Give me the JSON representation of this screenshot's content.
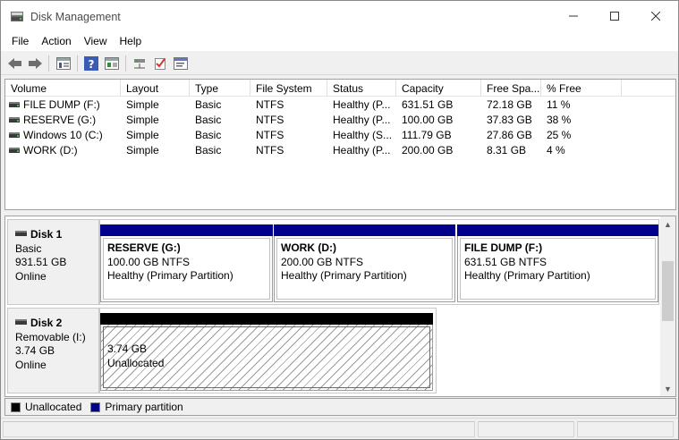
{
  "window": {
    "title": "Disk Management"
  },
  "menu": [
    "File",
    "Action",
    "View",
    "Help"
  ],
  "toolbar": [
    "back-icon",
    "forward-icon",
    "disk-list-icon",
    "help-icon",
    "properties-icon",
    "connect-icon",
    "check-icon",
    "console-icon"
  ],
  "volume_table": {
    "columns": [
      "Volume",
      "Layout",
      "Type",
      "File System",
      "Status",
      "Capacity",
      "Free Spa...",
      "% Free"
    ],
    "rows": [
      [
        "FILE DUMP (F:)",
        "Simple",
        "Basic",
        "NTFS",
        "Healthy (P...",
        "631.51 GB",
        "72.18 GB",
        "11 %"
      ],
      [
        "RESERVE (G:)",
        "Simple",
        "Basic",
        "NTFS",
        "Healthy (P...",
        "100.00 GB",
        "37.83 GB",
        "38 %"
      ],
      [
        "Windows 10 (C:)",
        "Simple",
        "Basic",
        "NTFS",
        "Healthy (S...",
        "111.79 GB",
        "27.86 GB",
        "25 %"
      ],
      [
        "WORK (D:)",
        "Simple",
        "Basic",
        "NTFS",
        "Healthy (P...",
        "200.00 GB",
        "8.31 GB",
        "4 %"
      ]
    ]
  },
  "disks": [
    {
      "name": "Disk 1",
      "type": "Basic",
      "size": "931.51 GB",
      "status": "Online",
      "partitions": [
        {
          "name": "RESERVE  (G:)",
          "size": "100.00 GB NTFS",
          "status": "Healthy (Primary Partition)"
        },
        {
          "name": "WORK  (D:)",
          "size": "200.00 GB NTFS",
          "status": "Healthy (Primary Partition)"
        },
        {
          "name": "FILE DUMP  (F:)",
          "size": "631.51 GB NTFS",
          "status": "Healthy (Primary Partition)"
        }
      ]
    },
    {
      "name": "Disk 2",
      "type": "Removable (I:)",
      "size": "3.74 GB",
      "status": "Online",
      "partitions": [
        {
          "size": "3.74 GB",
          "status": "Unallocated"
        }
      ]
    }
  ],
  "legend": [
    {
      "label": "Unallocated",
      "color": "#000000"
    },
    {
      "label": "Primary partition",
      "color": "#00008b"
    }
  ],
  "colors": {
    "primary_bar": "#00008b",
    "unallocated_bar": "#000000",
    "window_bg": "#f0f0f0"
  }
}
